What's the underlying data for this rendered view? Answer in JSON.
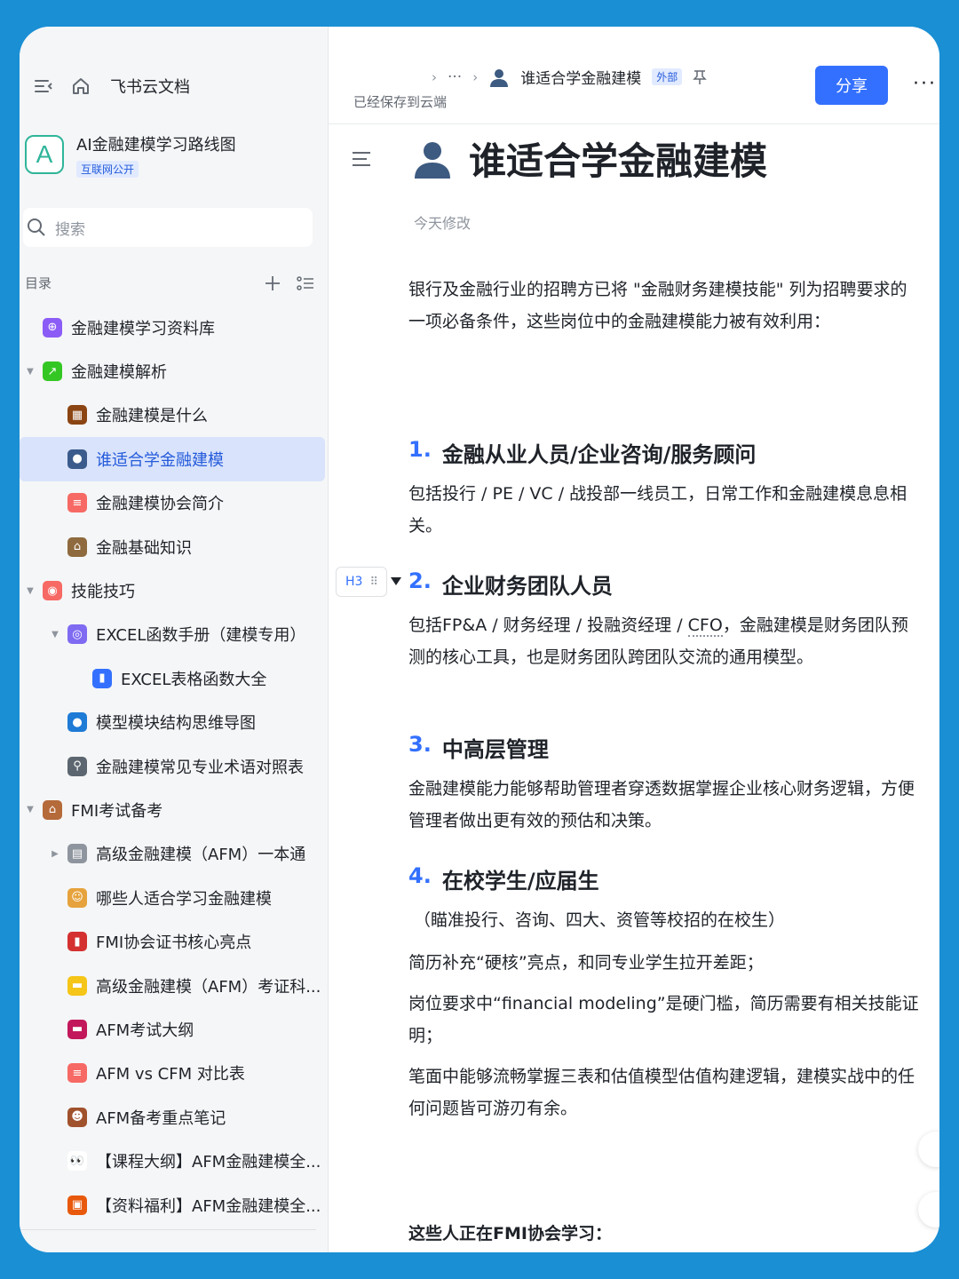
{
  "app": {
    "brand": "飞书云文档"
  },
  "wiki": {
    "logo_letter": "A",
    "title": "AI金融建模学习路线图",
    "badge": "互联网公开"
  },
  "search": {
    "placeholder": "搜索"
  },
  "toc": {
    "label": "目录",
    "items": [
      {
        "label": "金融建模学习资料库",
        "level": 0,
        "caret": "",
        "icon": "globe-icon",
        "color": "#8b5cf6",
        "glyph": "⊕"
      },
      {
        "label": "金融建模解析",
        "level": 0,
        "caret": "▼",
        "icon": "chart-icon",
        "color": "#34c724",
        "glyph": "↗"
      },
      {
        "label": "金融建模是什么",
        "level": 1,
        "caret": "",
        "icon": "abacus-icon",
        "color": "#8b4513",
        "glyph": "▦"
      },
      {
        "label": "谁适合学金融建模",
        "level": 1,
        "caret": "",
        "icon": "person-icon",
        "color": "#3b5b8c",
        "glyph": "●",
        "active": true
      },
      {
        "label": "金融建模协会简介",
        "level": 1,
        "caret": "",
        "icon": "doc-icon",
        "color": "#f76964",
        "glyph": "≡"
      },
      {
        "label": "金融基础知识",
        "level": 1,
        "caret": "",
        "icon": "bank-icon",
        "color": "#8f6a3e",
        "glyph": "⌂"
      },
      {
        "label": "技能技巧",
        "level": 0,
        "caret": "▼",
        "icon": "tool-icon",
        "color": "#f76964",
        "glyph": "◉"
      },
      {
        "label": "EXCEL函数手册（建模专用）",
        "level": 1,
        "caret": "▼",
        "icon": "target-icon",
        "color": "#7f6bf2",
        "glyph": "◎"
      },
      {
        "label": "EXCEL表格函数大全",
        "level": 2,
        "caret": "",
        "icon": "bar-chart-icon",
        "color": "#3370ff",
        "glyph": "▮"
      },
      {
        "label": "模型模块结构思维导图",
        "level": 1,
        "caret": "",
        "icon": "earth-icon",
        "color": "#1e7bd6",
        "glyph": "●"
      },
      {
        "label": "金融建模常见专业术语对照表",
        "level": 1,
        "caret": "",
        "icon": "magnifier-icon",
        "color": "#5c6670",
        "glyph": "⚲"
      },
      {
        "label": "FMI考试备考",
        "level": 0,
        "caret": "▼",
        "icon": "factory-icon",
        "color": "#b56a3a",
        "glyph": "⌂"
      },
      {
        "label": "高级金融建模（AFM）一本通",
        "level": 1,
        "caret": "▶",
        "icon": "notepad-icon",
        "color": "#8f959e",
        "glyph": "▤"
      },
      {
        "label": "哪些人适合学习金融建模",
        "level": 1,
        "caret": "",
        "icon": "student-icon",
        "color": "#e6a23c",
        "glyph": "☺"
      },
      {
        "label": "FMI协会证书核心亮点",
        "level": 1,
        "caret": "",
        "icon": "book-icon",
        "color": "#d43030",
        "glyph": "▮"
      },
      {
        "label": "高级金融建模（AFM）考证科...",
        "level": 1,
        "caret": "",
        "icon": "folder-icon",
        "color": "#f5c518",
        "glyph": "▬"
      },
      {
        "label": "AFM考试大纲",
        "level": 1,
        "caret": "",
        "icon": "ruler-icon",
        "color": "#c2185b",
        "glyph": "▬"
      },
      {
        "label": "AFM vs CFM 对比表",
        "level": 1,
        "caret": "",
        "icon": "doc-icon",
        "color": "#f76964",
        "glyph": "≡"
      },
      {
        "label": "AFM备考重点笔记",
        "level": 1,
        "caret": "",
        "icon": "monkey-icon",
        "color": "#a0522d",
        "glyph": "☻"
      },
      {
        "label": "【课程大纲】AFM金融建模全...",
        "level": 1,
        "caret": "",
        "icon": "eyes-icon",
        "color": "#ffffff",
        "glyph": "👀"
      },
      {
        "label": "【资料福利】AFM金融建模全...",
        "level": 1,
        "caret": "",
        "icon": "gift-icon",
        "color": "#e8590c",
        "glyph": "▣"
      }
    ]
  },
  "header": {
    "ellipsis": "···",
    "crumb_title": "谁适合学金融建模",
    "ext_badge": "外部",
    "saved": "已经保存到云端",
    "share": "分享",
    "more": "···"
  },
  "doc": {
    "title": "谁适合学金融建模",
    "modified": "今天修改",
    "intro": "银行及金融行业的招聘方已将 \"金融财务建模技能\" 列为招聘要求的一项必备条件，这些岗位中的金融建模能力被有效利用：",
    "h3_handle": "H3",
    "sections": [
      {
        "num": "1.",
        "title": "金融从业人员/企业咨询/服务顾问",
        "text": "包括投行 / PE / VC / 战投部一线员工，日常工作和金融建模息息相关。"
      },
      {
        "num": "2.",
        "title": "企业财务团队人员",
        "text_a": "包括FP&A / 财务经理 / 投融资经理 / ",
        "text_cfo": "CFO",
        "text_b": "，金融建模是财务团队预测的核心工具，也是财务团队跨团队交流的通用模型。"
      },
      {
        "num": "3.",
        "title": "中高层管理",
        "text": "金融建模能力能够帮助管理者穿透数据掌握企业核心财务逻辑，方便管理者做出更有效的预估和决策。"
      },
      {
        "num": "4.",
        "title": "在校学生/应届生",
        "p1": "（瞄准投行、咨询、四大、资管等校招的在校生）",
        "p2": "简历补充“硬核”亮点，和同专业学生拉开差距；",
        "p3": "岗位要求中“financial modeling”是硬门槛，简历需要有相关技能证明；",
        "p4": "笔面中能够流畅掌握三表和估值模型估值构建逻辑，建模实战中的任何问题皆可游刃有余。"
      }
    ],
    "footer_bold": "这些人正在FMI协会学习："
  }
}
